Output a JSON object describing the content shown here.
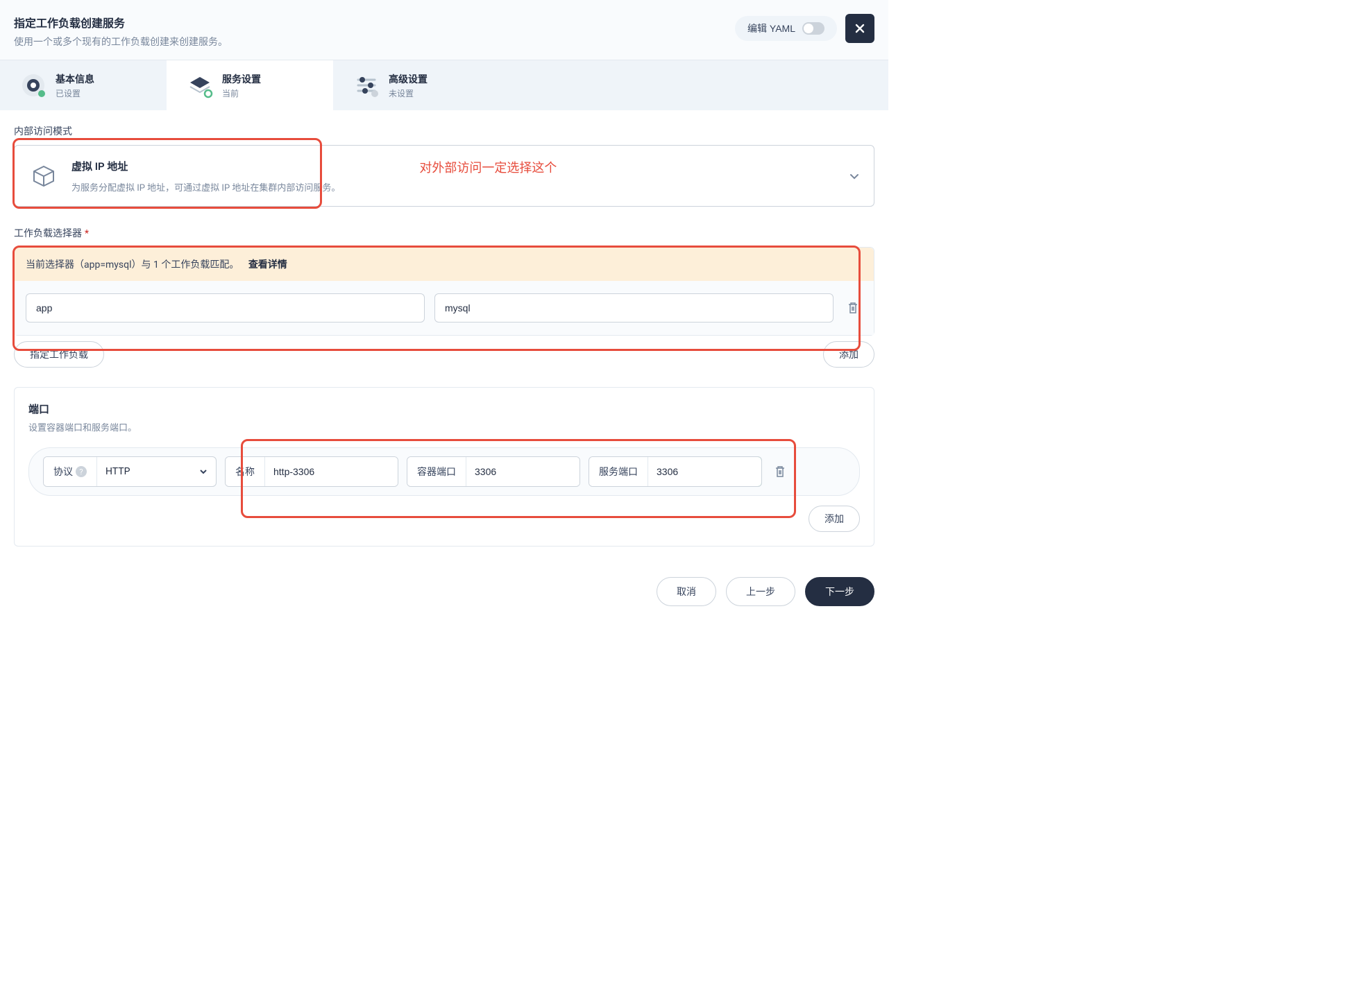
{
  "header": {
    "title": "指定工作负载创建服务",
    "subtitle": "使用一个或多个现有的工作负载创建来创建服务。",
    "yaml_label": "编辑 YAML"
  },
  "tabs": {
    "basic": {
      "title": "基本信息",
      "status": "已设置"
    },
    "settings": {
      "title": "服务设置",
      "status": "当前"
    },
    "advanced": {
      "title": "高级设置",
      "status": "未设置"
    }
  },
  "access_mode": {
    "label": "内部访问模式",
    "title": "虚拟 IP 地址",
    "desc": "为服务分配虚拟 IP 地址，可通过虚拟 IP 地址在集群内部访问服务。",
    "annotation": "对外部访问一定选择这个"
  },
  "selector": {
    "label": "工作负载选择器",
    "banner_text": "当前选择器（app=mysql）与 1 个工作负载匹配。",
    "banner_link": "查看详情",
    "key": "app",
    "value": "mysql",
    "specify_btn": "指定工作负载",
    "add_btn": "添加"
  },
  "ports": {
    "title": "端口",
    "desc": "设置容器端口和服务端口。",
    "protocol_label": "协议",
    "protocol_value": "HTTP",
    "name_label": "名称",
    "name_value": "http-3306",
    "container_port_label": "容器端口",
    "container_port_value": "3306",
    "service_port_label": "服务端口",
    "service_port_value": "3306",
    "add_btn": "添加"
  },
  "footer": {
    "cancel": "取消",
    "prev": "上一步",
    "next": "下一步"
  }
}
